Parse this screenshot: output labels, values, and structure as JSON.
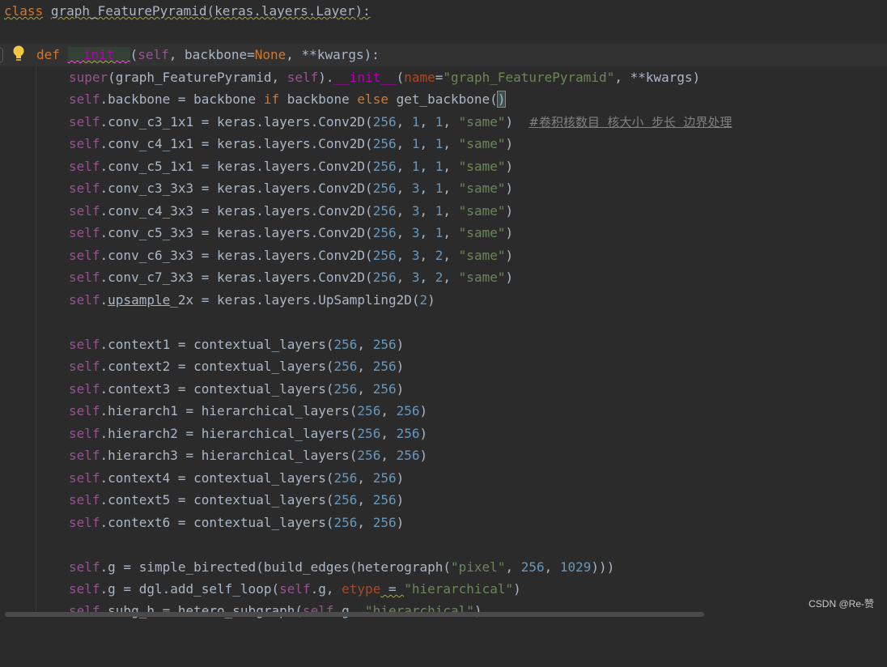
{
  "colors": {
    "background": "#2b2b2b",
    "keyword": "#cc7832",
    "self": "#94558d",
    "number": "#6897bb",
    "string": "#6a8759",
    "parameter": "#aa4926",
    "magic": "#b200b2",
    "comment": "#808080",
    "default_text": "#a9b7c6"
  },
  "gutter": {
    "intention_icon": "lightbulb-icon"
  },
  "code": {
    "class_kw": "class",
    "class_name": "graph_FeaturePyramid",
    "class_bases": "(keras.layers.Layer):",
    "def_kw": "def",
    "init_name": "__init__",
    "init_open": "(",
    "self": "self",
    "comma": ", ",
    "backbone_param": "backbone=",
    "none_kw": "None",
    "kwargs_close": "**kwargs):",
    "super_call": "super",
    "super_mid": "(graph_FeaturePyramid, ",
    "super_close": ").",
    "init_open2": "(",
    "name_kw": "name",
    "eq": "=",
    "name_str": "\"graph_FeaturePyramid\"",
    "kwargs_tail": ", **kwargs)",
    "backbone_line_a": ".backbone = backbone ",
    "if_kw": "if",
    "backbone_line_b": " backbone ",
    "else_kw": "else",
    "backbone_line_c": " get_backbone(",
    "backbone_line_d": ")",
    "conv_lines": [
      {
        "lhs": ".conv_c3_1x1 = keras.layers.Conv2D(",
        "a": "256",
        "b": "1",
        "c": "1",
        "s": "\"same\""
      },
      {
        "lhs": ".conv_c4_1x1 = keras.layers.Conv2D(",
        "a": "256",
        "b": "1",
        "c": "1",
        "s": "\"same\""
      },
      {
        "lhs": ".conv_c5_1x1 = keras.layers.Conv2D(",
        "a": "256",
        "b": "1",
        "c": "1",
        "s": "\"same\""
      },
      {
        "lhs": ".conv_c3_3x3 = keras.layers.Conv2D(",
        "a": "256",
        "b": "3",
        "c": "1",
        "s": "\"same\""
      },
      {
        "lhs": ".conv_c4_3x3 = keras.layers.Conv2D(",
        "a": "256",
        "b": "3",
        "c": "1",
        "s": "\"same\""
      },
      {
        "lhs": ".conv_c5_3x3 = keras.layers.Conv2D(",
        "a": "256",
        "b": "3",
        "c": "1",
        "s": "\"same\""
      },
      {
        "lhs": ".conv_c6_3x3 = keras.layers.Conv2D(",
        "a": "256",
        "b": "3",
        "c": "2",
        "s": "\"same\""
      },
      {
        "lhs": ".conv_c7_3x3 = keras.layers.Conv2D(",
        "a": "256",
        "b": "3",
        "c": "2",
        "s": "\"same\""
      }
    ],
    "conv_comment": "#卷积核数目  核大小  步长  边界处理",
    "upsample_a": ".",
    "upsample_b": "upsample",
    "upsample_c": "_2x = keras.layers.UpSampling2D(",
    "upsample_num": "2",
    "close_paren": ")",
    "layer_lines": [
      {
        "lhs": ".context1 = contextual_layers(",
        "a": "256",
        "b": "256"
      },
      {
        "lhs": ".context2 = contextual_layers(",
        "a": "256",
        "b": "256"
      },
      {
        "lhs": ".context3 = contextual_layers(",
        "a": "256",
        "b": "256"
      },
      {
        "lhs": ".hierarch1 = hierarchical_layers(",
        "a": "256",
        "b": "256"
      },
      {
        "lhs": ".hierarch2 = hierarchical_layers(",
        "a": "256",
        "b": "256"
      },
      {
        "lhs": ".hierarch3 = hierarchical_layers(",
        "a": "256",
        "b": "256"
      },
      {
        "lhs": ".context4 = contextual_layers(",
        "a": "256",
        "b": "256"
      },
      {
        "lhs": ".context5 = contextual_layers(",
        "a": "256",
        "b": "256"
      },
      {
        "lhs": ".context6 = contextual_layers(",
        "a": "256",
        "b": "256"
      }
    ],
    "g_line1_a": ".g = simple_birected(build_edges(heterograph(",
    "g_line1_str": "\"pixel\"",
    "g_line1_n1": "256",
    "g_line1_n2": "1029",
    "g_line1_close": ")))",
    "g_line2_a": ".g = dgl.add_self_loop(",
    "g_line2_b": ".g, ",
    "etype_kw": "etype",
    "g_line2_eq": " = ",
    "g_line2_str": "\"hierarchical\"",
    "subg_a": ".subg_h = hetero_subgraph(",
    "subg_b": ".g, ",
    "subg_str": "\"hierarchical\"",
    "subg_close": ")"
  },
  "watermark": "CSDN @Re-赞"
}
